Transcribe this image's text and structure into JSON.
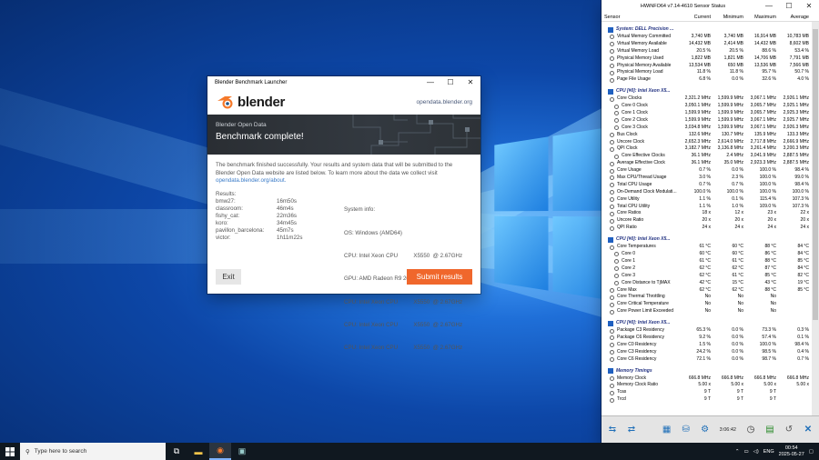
{
  "blender": {
    "title": "Blender Benchmark Launcher",
    "logo_text": "blender",
    "link": "opendata.blender.org",
    "banner_sub": "Blender Open Data",
    "banner_title": "Benchmark complete!",
    "message": "The benchmark finished successfully. Your results and system data that will be submitted to the Blender Open Data website are listed below. To learn more about the data we collect visit",
    "message_link": "opendata.blender.org/about.",
    "results_label": "Results:",
    "sysinfo_label": "System info:",
    "results": [
      {
        "k": "bmw27:",
        "v": "16m50s"
      },
      {
        "k": "classroom:",
        "v": "46m4s"
      },
      {
        "k": "fishy_cat:",
        "v": "22m36s"
      },
      {
        "k": "koro:",
        "v": "34m45s"
      },
      {
        "k": "pavillon_barcelona:",
        "v": "45m7s"
      },
      {
        "k": "victor:",
        "v": "1h11m22s"
      }
    ],
    "sysinfo": [
      "OS: Windows (AMD64)",
      "CPU: Intel Xeon CPU          X5550  @ 2.67GHz",
      "GPU: AMD Radeon R9 200 Series",
      "CPU: Intel Xeon CPU          X5550  @ 2.67GHz",
      "CPU: Intel Xeon CPU          X5550  @ 2.67GHz",
      "CPU: Intel Xeon CPU          X5550  @ 2.67GHz"
    ],
    "exit_label": "Exit",
    "submit_label": "Submit results"
  },
  "hwinfo": {
    "title": "HWiNFO64 v7.14-4610 Sensor Status",
    "columns": [
      "Sensor",
      "Current",
      "Minimum",
      "Maximum",
      "Average"
    ],
    "groups": [
      {
        "title": "System: DELL Precision ...",
        "rows": [
          [
            "Virtual Memory Committed",
            "3,740 MB",
            "3,740 MB",
            "16,914 MB",
            "10,783 MB"
          ],
          [
            "Virtual Memory Available",
            "14,432 MB",
            "2,414 MB",
            "14,432 MB",
            "8,602 MB"
          ],
          [
            "Virtual Memory Load",
            "20.5 %",
            "20.5 %",
            "88.6 %",
            "53.4 %"
          ],
          [
            "Physical Memory Used",
            "1,822 MB",
            "1,821 MB",
            "14,706 MB",
            "7,791 MB"
          ],
          [
            "Physical Memory Available",
            "13,534 MB",
            "650 MB",
            "13,536 MB",
            "7,566 MB"
          ],
          [
            "Physical Memory Load",
            "11.8 %",
            "11.8 %",
            "95.7 %",
            "50.7 %"
          ],
          [
            "Page File Usage",
            "6.8 %",
            "0.0 %",
            "32.6 %",
            "4.0 %"
          ]
        ]
      },
      {
        "title": "CPU [#0]: Intel Xeon X5...",
        "rows": [
          [
            "Core Clocks",
            "2,321.2 MHz",
            "1,599.9 MHz",
            "3,067.1 MHz",
            "2,926.1 MHz"
          ],
          [
            "Core 0 Clock",
            "3,050.1 MHz",
            "1,599.9 MHz",
            "3,065.7 MHz",
            "2,925.1 MHz"
          ],
          [
            "Core 1 Clock",
            "1,599.9 MHz",
            "1,599.9 MHz",
            "3,065.7 MHz",
            "2,925.3 MHz"
          ],
          [
            "Core 2 Clock",
            "1,599.9 MHz",
            "1,599.9 MHz",
            "3,067.1 MHz",
            "2,925.7 MHz"
          ],
          [
            "Core 3 Clock",
            "3,034.8 MHz",
            "1,599.9 MHz",
            "3,067.1 MHz",
            "2,926.3 MHz"
          ],
          [
            "Bus Clock",
            "132.6 MHz",
            "130.7 MHz",
            "135.9 MHz",
            "133.3 MHz"
          ],
          [
            "Uncore Clock",
            "2,652.3 MHz",
            "2,614.0 MHz",
            "2,717.8 MHz",
            "2,666.9 MHz"
          ],
          [
            "QPI Clock",
            "3,182.7 MHz",
            "3,136.8 MHz",
            "3,261.4 MHz",
            "3,200.3 MHz"
          ],
          [
            "Core Effective Clocks",
            "36.1 MHz",
            "2.4 MHz",
            "3,041.9 MHz",
            "2,887.5 MHz"
          ],
          [
            "Average Effective Clock",
            "36.1 MHz",
            "35.0 MHz",
            "2,923.3 MHz",
            "2,887.5 MHz"
          ],
          [
            "Core Usage",
            "0.7 %",
            "0.0 %",
            "100.0 %",
            "98.4 %"
          ],
          [
            "Max CPU/Thread Usage",
            "3.0 %",
            "2.3 %",
            "100.0 %",
            "99.0 %"
          ],
          [
            "Total CPU Usage",
            "0.7 %",
            "0.7 %",
            "100.0 %",
            "98.4 %"
          ],
          [
            "On-Demand Clock Modulati...",
            "100.0 %",
            "100.0 %",
            "100.0 %",
            "100.0 %"
          ],
          [
            "Core Utility",
            "1.1 %",
            "0.1 %",
            "115.4 %",
            "107.3 %"
          ],
          [
            "Total CPU Utility",
            "1.1 %",
            "1.0 %",
            "109.0 %",
            "107.3 %"
          ],
          [
            "Core Ratios",
            "18 x",
            "12 x",
            "23 x",
            "22 x"
          ],
          [
            "Uncore Ratio",
            "20 x",
            "20 x",
            "20 x",
            "20 x"
          ],
          [
            "QPI Ratio",
            "24 x",
            "24 x",
            "24 x",
            "24 x"
          ]
        ]
      },
      {
        "title": "CPU [#0]: Intel Xeon X5...",
        "rows": [
          [
            "Core Temperatures",
            "61 °C",
            "60 °C",
            "88 °C",
            "84 °C"
          ],
          [
            "Core 0",
            "60 °C",
            "60 °C",
            "86 °C",
            "84 °C"
          ],
          [
            "Core 1",
            "61 °C",
            "61 °C",
            "88 °C",
            "85 °C"
          ],
          [
            "Core 2",
            "62 °C",
            "62 °C",
            "87 °C",
            "84 °C"
          ],
          [
            "Core 3",
            "62 °C",
            "61 °C",
            "85 °C",
            "82 °C"
          ],
          [
            "Core Distance to TjMAX",
            "42 °C",
            "15 °C",
            "43 °C",
            "19 °C"
          ],
          [
            "Core Max",
            "62 °C",
            "62 °C",
            "88 °C",
            "85 °C"
          ],
          [
            "Core Thermal Throttling",
            "No",
            "No",
            "No",
            ""
          ],
          [
            "Core Critical Temperature",
            "No",
            "No",
            "No",
            ""
          ],
          [
            "Core Power Limit Exceeded",
            "No",
            "No",
            "No",
            ""
          ]
        ]
      },
      {
        "title": "CPU [#0]: Intel Xeon X5...",
        "rows": [
          [
            "Package C3 Residency",
            "65.3 %",
            "0.0 %",
            "73.3 %",
            "0.3 %"
          ],
          [
            "Package C6 Residency",
            "9.2 %",
            "0.0 %",
            "57.4 %",
            "0.1 %"
          ],
          [
            "Core C0 Residency",
            "1.5 %",
            "0.0 %",
            "100.0 %",
            "98.4 %"
          ],
          [
            "Core C3 Residency",
            "24.2 %",
            "0.0 %",
            "98.5 %",
            "0.4 %"
          ],
          [
            "Core C6 Residency",
            "72.1 %",
            "0.0 %",
            "98.7 %",
            "0.7 %"
          ]
        ]
      },
      {
        "title": "Memory Timings",
        "rows": [
          [
            "Memory Clock",
            "666.8 MHz",
            "666.8 MHz",
            "666.8 MHz",
            "666.8 MHz"
          ],
          [
            "Memory Clock Ratio",
            "5.00 x",
            "5.00 x",
            "5.00 x",
            "5.00 x"
          ],
          [
            "Tcas",
            "9 T",
            "9 T",
            "9 T",
            ""
          ],
          [
            "Trcd",
            "9 T",
            "9 T",
            "9 T",
            ""
          ]
        ]
      }
    ],
    "elapsed": "3:06:42"
  },
  "watermark": {
    "line1": "Activate Windows",
    "line2": "Go to Settings to activate Windows."
  },
  "taskbar": {
    "search_placeholder": "Type here to search",
    "lang": "ENG",
    "time": "00:54",
    "date": "2025-05-27"
  }
}
